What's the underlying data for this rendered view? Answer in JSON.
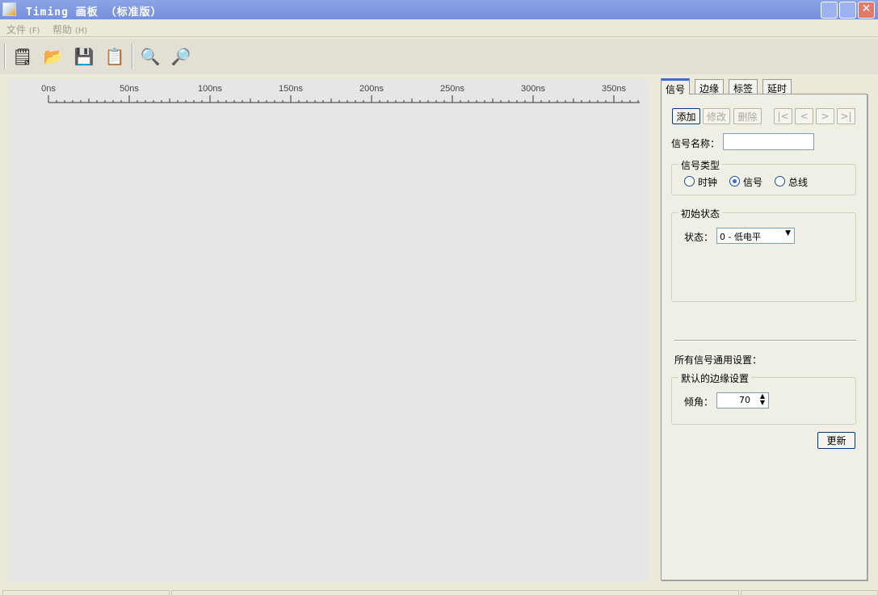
{
  "window": {
    "title": "Timing 画板  （标准版）"
  },
  "menu": [
    {
      "label": "文件",
      "key": "(F)"
    },
    {
      "label": "帮助",
      "key": "(H)"
    }
  ],
  "toolbar": [
    "new-icon",
    "open-icon",
    "save-icon",
    "save-as-icon",
    "zoom-in-icon",
    "zoom-out-icon"
  ],
  "ruler": {
    "labels": [
      "0ns",
      "50ns",
      "100ns",
      "150ns",
      "200ns",
      "250ns",
      "300ns",
      "350ns"
    ]
  },
  "panel": {
    "tabs": [
      "信号",
      "边缘",
      "标签",
      "延时"
    ],
    "active_tab": "信号",
    "buttons": {
      "add": "添加",
      "modify": "修改",
      "delete": "删除",
      "first": "|<",
      "prev": "<",
      "next": ">",
      "last": ">|"
    },
    "signal_name_label": "信号名称：",
    "signal_name_value": "",
    "type_group": "信号类型",
    "types": [
      "时钟",
      "信号",
      "总线"
    ],
    "selected_type": "信号",
    "init_group": "初始状态",
    "state_label": "状态：",
    "state_value": "0 - 低电平",
    "common_label": "所有信号通用设置：",
    "edge_group": "默认的边缘设置",
    "slope_label": "倾角：",
    "slope_value": "70",
    "update": "更新"
  }
}
